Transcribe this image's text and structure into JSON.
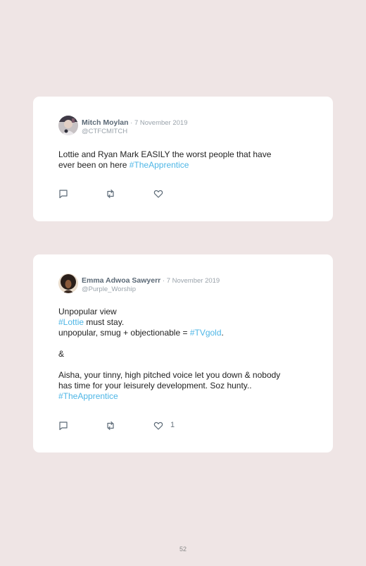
{
  "tweets": [
    {
      "name": "Mitch Moylan",
      "separator": " · ",
      "date": "7 November 2019",
      "handle": "@CTFCMITCH",
      "lines": [
        {
          "parts": [
            {
              "text": "Lottie and Ryan Mark EASILY the worst people that have",
              "tag": false
            }
          ]
        },
        {
          "parts": [
            {
              "text": "ever been on here ",
              "tag": false
            },
            {
              "text": "#TheApprentice",
              "tag": true
            }
          ]
        }
      ],
      "like_count": ""
    },
    {
      "name": "Emma Adwoa Sawyerr",
      "separator": " · ",
      "date": "7 November 2019",
      "handle": "@Purple_Worship",
      "lines": [
        {
          "parts": [
            {
              "text": "Unpopular view",
              "tag": false
            }
          ]
        },
        {
          "parts": [
            {
              "text": "#Lottie",
              "tag": true
            },
            {
              "text": " must stay.",
              "tag": false
            }
          ]
        },
        {
          "parts": [
            {
              "text": "unpopular, smug + objectionable = ",
              "tag": false
            },
            {
              "text": "#TVgold",
              "tag": true
            },
            {
              "text": ".",
              "tag": false
            }
          ]
        },
        {
          "parts": []
        },
        {
          "parts": [
            {
              "text": "&",
              "tag": false
            }
          ]
        },
        {
          "parts": []
        },
        {
          "parts": [
            {
              "text": "Aisha, your tinny, high pitched voice let you down & nobody",
              "tag": false
            }
          ]
        },
        {
          "parts": [
            {
              "text": "has time for your leisurely development. Soz hunty..",
              "tag": false
            }
          ]
        },
        {
          "parts": [
            {
              "text": "#TheApprentice",
              "tag": true
            }
          ]
        }
      ],
      "like_count": "1"
    }
  ],
  "page_number": "52",
  "icons": {
    "reply": "comment-icon",
    "retweet": "retweet-icon",
    "like": "heart-icon"
  },
  "colors": {
    "hashtag": "#4eb6e6",
    "background": "#efe5e5",
    "card": "#ffffff"
  }
}
